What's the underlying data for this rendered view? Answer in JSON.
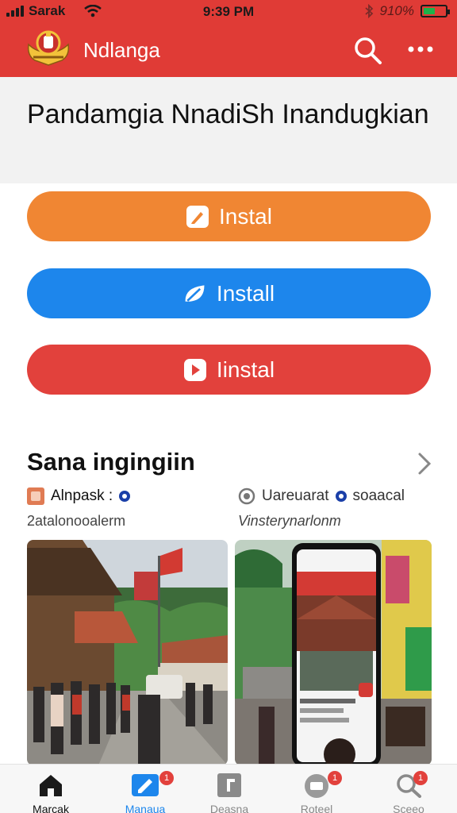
{
  "status_bar": {
    "carrier": "Sarak",
    "time": "9:39 PM",
    "battery": "910%"
  },
  "app": {
    "title": "Ndlanga"
  },
  "header": {
    "title": "Pandamgia NnadiSh Inandugkian"
  },
  "buttons": [
    {
      "label": "Instal",
      "color": "#f08633",
      "icon": "edit-icon"
    },
    {
      "label": "Install",
      "color": "#1d86ec",
      "icon": "leaf-icon"
    },
    {
      "label": "Iinstal",
      "color": "#e2413c",
      "icon": "play-icon"
    }
  ],
  "section": {
    "title": "Sana ingingiin",
    "left": {
      "source": "Alnpask :",
      "subtitle": "2atalonooalerm"
    },
    "right": {
      "source": "Uareuarat",
      "tag": "soaacal",
      "subtitle": "Vinsterynarlonm"
    }
  },
  "bottom_nav": [
    {
      "label": "Marcak",
      "icon": "home-icon"
    },
    {
      "label": "Manaua",
      "icon": "edit-icon",
      "badge": "1"
    },
    {
      "label": "Deasna",
      "icon": "document-icon"
    },
    {
      "label": "Roteel",
      "icon": "folder-icon",
      "badge": "1"
    },
    {
      "label": "Sceeo",
      "icon": "search-icon",
      "badge": "1"
    }
  ]
}
